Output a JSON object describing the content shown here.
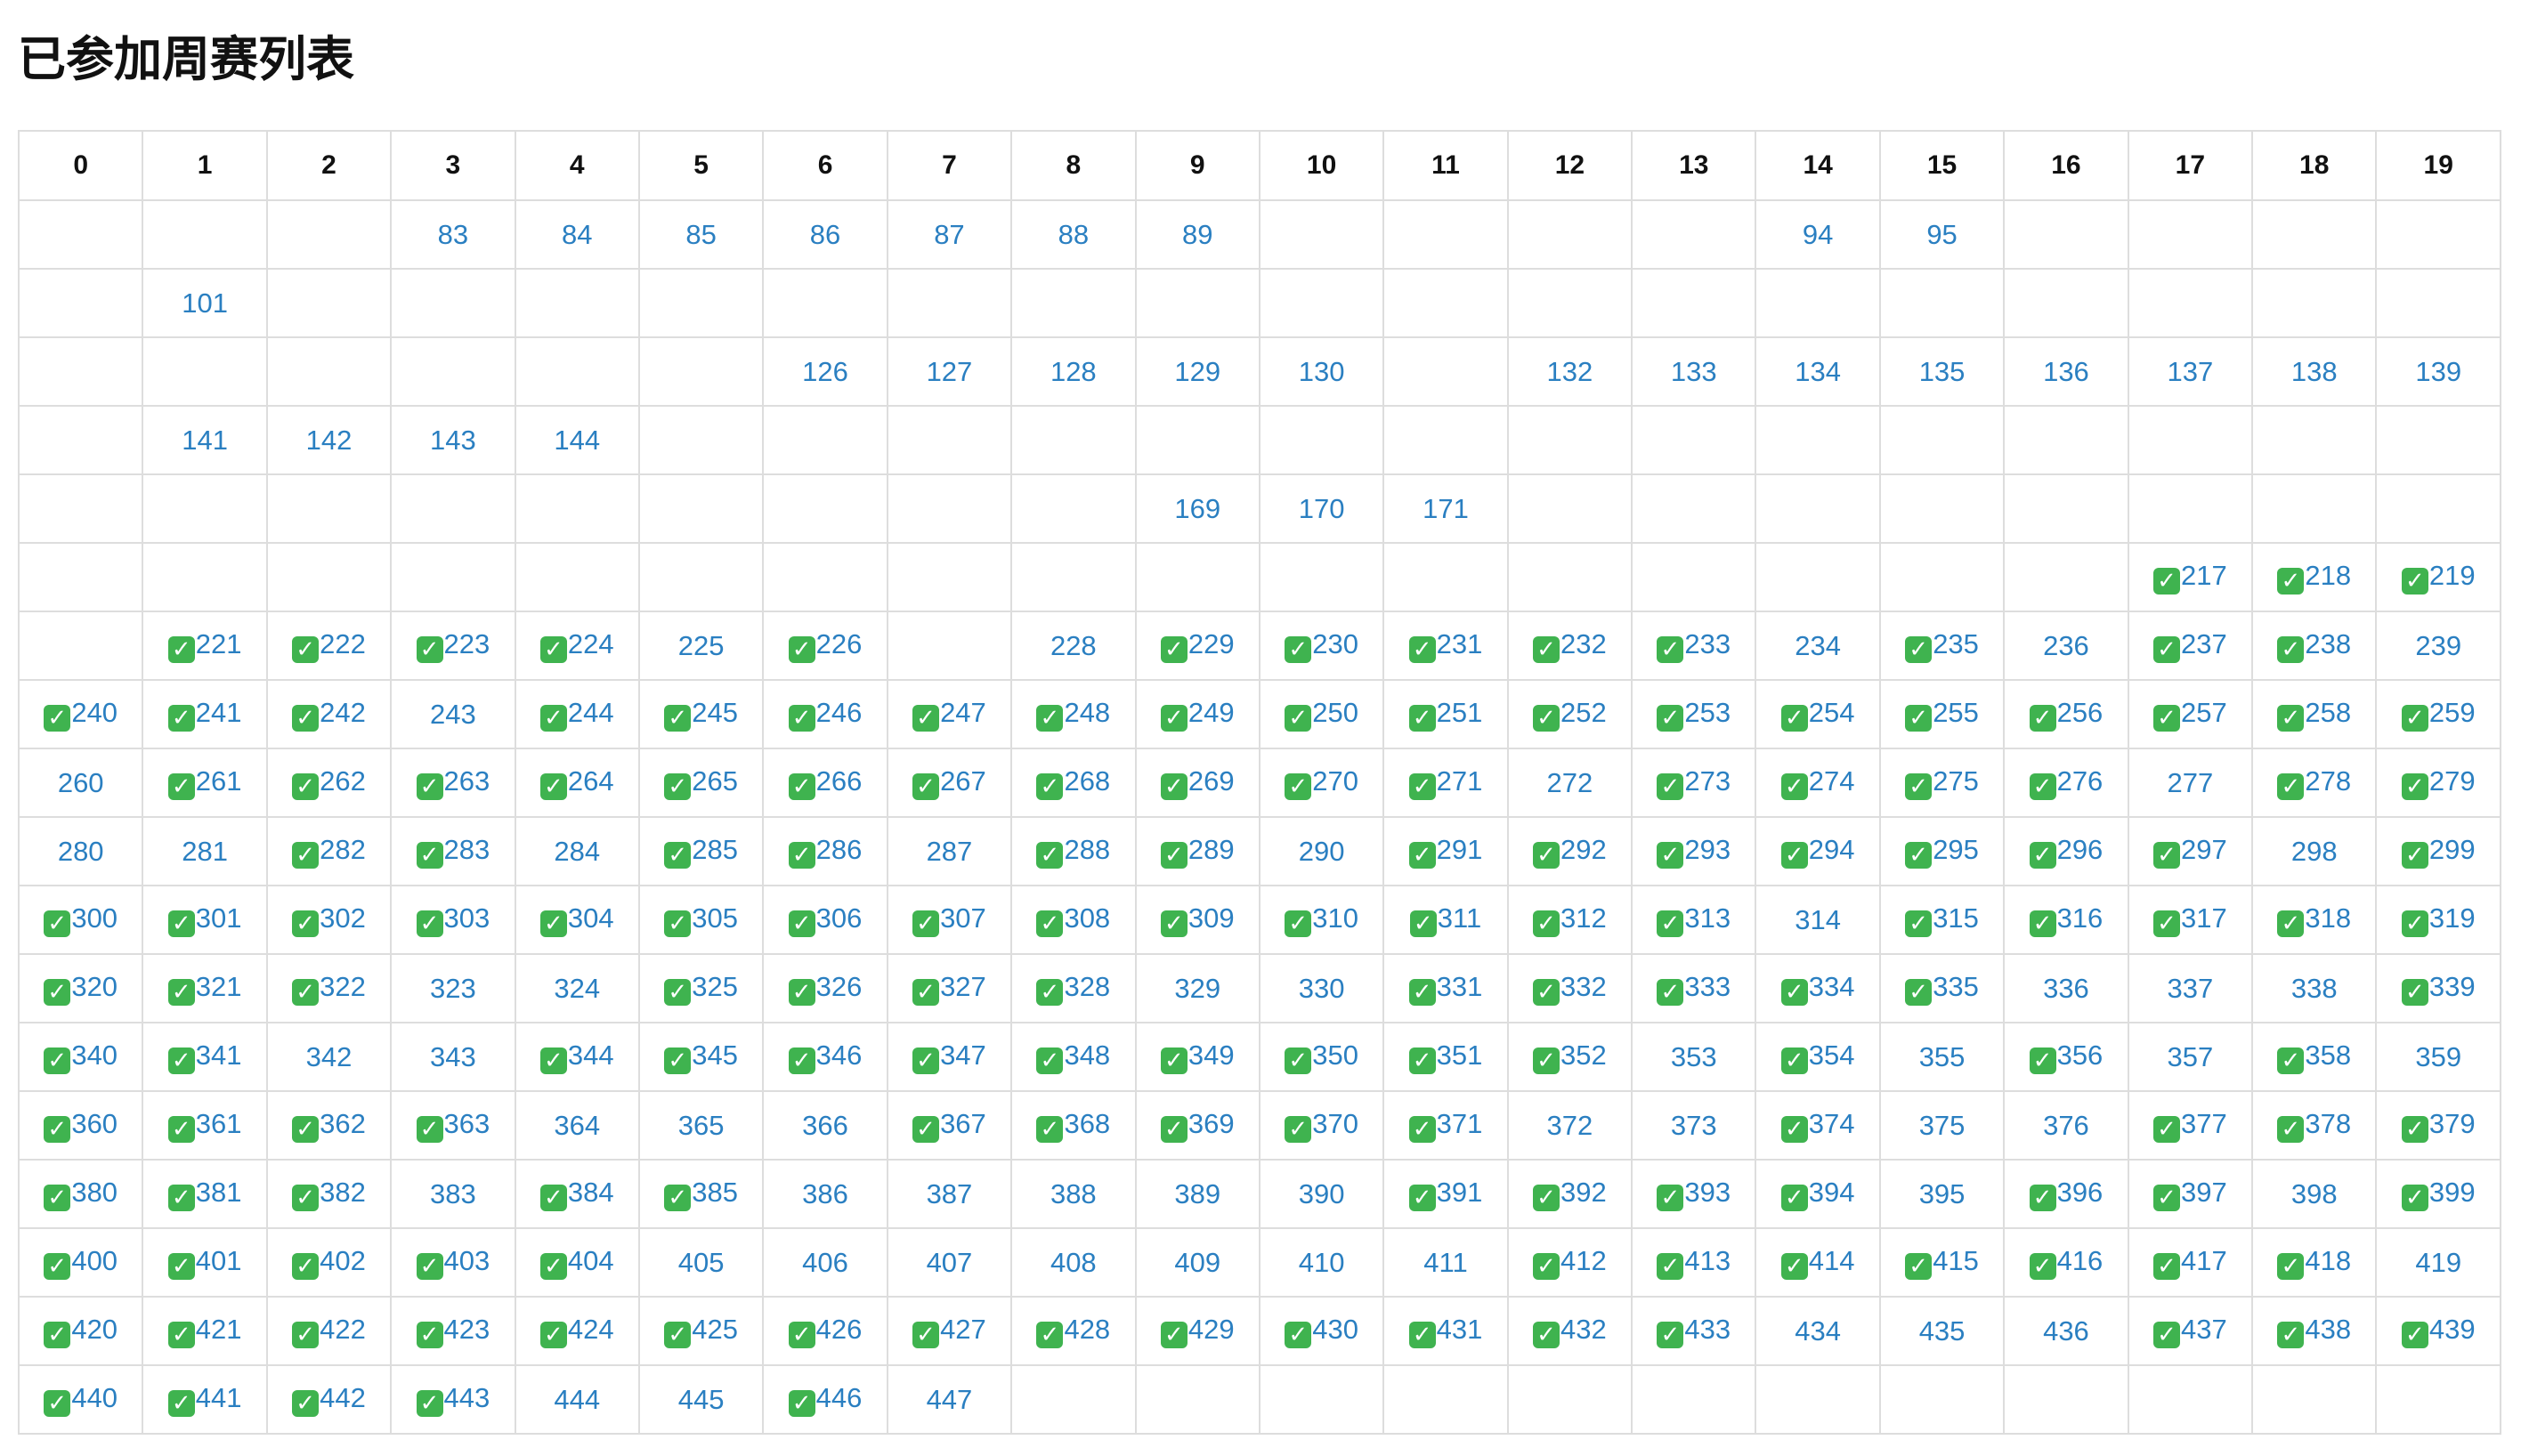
{
  "page": {
    "title": "已参加周赛列表"
  },
  "table": {
    "headers": [
      "0",
      "1",
      "2",
      "3",
      "4",
      "5",
      "6",
      "7",
      "8",
      "9",
      "10",
      "11",
      "12",
      "13",
      "14",
      "15",
      "16",
      "17",
      "18",
      "19"
    ],
    "rows": [
      [
        null,
        null,
        null,
        {
          "id": "83"
        },
        {
          "id": "84"
        },
        {
          "id": "85"
        },
        {
          "id": "86"
        },
        {
          "id": "87"
        },
        {
          "id": "88"
        },
        {
          "id": "89"
        },
        null,
        null,
        null,
        null,
        {
          "id": "94"
        },
        {
          "id": "95"
        },
        null,
        null,
        null,
        null
      ],
      [
        null,
        {
          "id": "101"
        },
        null,
        null,
        null,
        null,
        null,
        null,
        null,
        null,
        null,
        null,
        null,
        null,
        null,
        null,
        null,
        null,
        null,
        null
      ],
      [
        null,
        null,
        null,
        null,
        null,
        null,
        {
          "id": "126"
        },
        {
          "id": "127"
        },
        {
          "id": "128"
        },
        {
          "id": "129"
        },
        {
          "id": "130"
        },
        null,
        {
          "id": "132"
        },
        {
          "id": "133"
        },
        {
          "id": "134"
        },
        {
          "id": "135"
        },
        {
          "id": "136"
        },
        {
          "id": "137"
        },
        {
          "id": "138"
        },
        {
          "id": "139"
        }
      ],
      [
        null,
        {
          "id": "141"
        },
        {
          "id": "142"
        },
        {
          "id": "143"
        },
        {
          "id": "144"
        },
        null,
        null,
        null,
        null,
        null,
        null,
        null,
        null,
        null,
        null,
        null,
        null,
        null,
        null,
        null
      ],
      [
        null,
        null,
        null,
        null,
        null,
        null,
        null,
        null,
        null,
        {
          "id": "169"
        },
        {
          "id": "170"
        },
        {
          "id": "171"
        },
        null,
        null,
        null,
        null,
        null,
        null,
        null,
        null
      ],
      [
        null,
        null,
        null,
        null,
        null,
        null,
        null,
        null,
        null,
        null,
        null,
        null,
        null,
        null,
        null,
        null,
        null,
        {
          "id": "217",
          "done": true
        },
        {
          "id": "218",
          "done": true
        },
        {
          "id": "219",
          "done": true
        }
      ],
      [
        null,
        {
          "id": "221",
          "done": true
        },
        {
          "id": "222",
          "done": true
        },
        {
          "id": "223",
          "done": true
        },
        {
          "id": "224",
          "done": true
        },
        {
          "id": "225"
        },
        {
          "id": "226",
          "done": true
        },
        null,
        {
          "id": "228"
        },
        {
          "id": "229",
          "done": true
        },
        {
          "id": "230",
          "done": true
        },
        {
          "id": "231",
          "done": true
        },
        {
          "id": "232",
          "done": true
        },
        {
          "id": "233",
          "done": true
        },
        {
          "id": "234"
        },
        {
          "id": "235",
          "done": true
        },
        {
          "id": "236"
        },
        {
          "id": "237",
          "done": true
        },
        {
          "id": "238",
          "done": true
        },
        {
          "id": "239"
        }
      ],
      [
        {
          "id": "240",
          "done": true
        },
        {
          "id": "241",
          "done": true
        },
        {
          "id": "242",
          "done": true
        },
        {
          "id": "243"
        },
        {
          "id": "244",
          "done": true
        },
        {
          "id": "245",
          "done": true
        },
        {
          "id": "246",
          "done": true
        },
        {
          "id": "247",
          "done": true
        },
        {
          "id": "248",
          "done": true
        },
        {
          "id": "249",
          "done": true
        },
        {
          "id": "250",
          "done": true
        },
        {
          "id": "251",
          "done": true
        },
        {
          "id": "252",
          "done": true
        },
        {
          "id": "253",
          "done": true
        },
        {
          "id": "254",
          "done": true
        },
        {
          "id": "255",
          "done": true
        },
        {
          "id": "256",
          "done": true
        },
        {
          "id": "257",
          "done": true
        },
        {
          "id": "258",
          "done": true
        },
        {
          "id": "259",
          "done": true
        }
      ],
      [
        {
          "id": "260"
        },
        {
          "id": "261",
          "done": true
        },
        {
          "id": "262",
          "done": true
        },
        {
          "id": "263",
          "done": true
        },
        {
          "id": "264",
          "done": true
        },
        {
          "id": "265",
          "done": true
        },
        {
          "id": "266",
          "done": true
        },
        {
          "id": "267",
          "done": true
        },
        {
          "id": "268",
          "done": true
        },
        {
          "id": "269",
          "done": true
        },
        {
          "id": "270",
          "done": true
        },
        {
          "id": "271",
          "done": true
        },
        {
          "id": "272"
        },
        {
          "id": "273",
          "done": true
        },
        {
          "id": "274",
          "done": true
        },
        {
          "id": "275",
          "done": true
        },
        {
          "id": "276",
          "done": true
        },
        {
          "id": "277"
        },
        {
          "id": "278",
          "done": true
        },
        {
          "id": "279",
          "done": true
        }
      ],
      [
        {
          "id": "280"
        },
        {
          "id": "281"
        },
        {
          "id": "282",
          "done": true
        },
        {
          "id": "283",
          "done": true
        },
        {
          "id": "284"
        },
        {
          "id": "285",
          "done": true
        },
        {
          "id": "286",
          "done": true
        },
        {
          "id": "287"
        },
        {
          "id": "288",
          "done": true
        },
        {
          "id": "289",
          "done": true
        },
        {
          "id": "290"
        },
        {
          "id": "291",
          "done": true
        },
        {
          "id": "292",
          "done": true
        },
        {
          "id": "293",
          "done": true
        },
        {
          "id": "294",
          "done": true
        },
        {
          "id": "295",
          "done": true
        },
        {
          "id": "296",
          "done": true
        },
        {
          "id": "297",
          "done": true
        },
        {
          "id": "298"
        },
        {
          "id": "299",
          "done": true
        }
      ],
      [
        {
          "id": "300",
          "done": true
        },
        {
          "id": "301",
          "done": true
        },
        {
          "id": "302",
          "done": true
        },
        {
          "id": "303",
          "done": true
        },
        {
          "id": "304",
          "done": true
        },
        {
          "id": "305",
          "done": true
        },
        {
          "id": "306",
          "done": true
        },
        {
          "id": "307",
          "done": true
        },
        {
          "id": "308",
          "done": true
        },
        {
          "id": "309",
          "done": true
        },
        {
          "id": "310",
          "done": true
        },
        {
          "id": "311",
          "done": true
        },
        {
          "id": "312",
          "done": true
        },
        {
          "id": "313",
          "done": true
        },
        {
          "id": "314"
        },
        {
          "id": "315",
          "done": true
        },
        {
          "id": "316",
          "done": true
        },
        {
          "id": "317",
          "done": true
        },
        {
          "id": "318",
          "done": true
        },
        {
          "id": "319",
          "done": true
        }
      ],
      [
        {
          "id": "320",
          "done": true
        },
        {
          "id": "321",
          "done": true
        },
        {
          "id": "322",
          "done": true
        },
        {
          "id": "323"
        },
        {
          "id": "324"
        },
        {
          "id": "325",
          "done": true
        },
        {
          "id": "326",
          "done": true
        },
        {
          "id": "327",
          "done": true
        },
        {
          "id": "328",
          "done": true
        },
        {
          "id": "329"
        },
        {
          "id": "330"
        },
        {
          "id": "331",
          "done": true
        },
        {
          "id": "332",
          "done": true
        },
        {
          "id": "333",
          "done": true
        },
        {
          "id": "334",
          "done": true
        },
        {
          "id": "335",
          "done": true
        },
        {
          "id": "336"
        },
        {
          "id": "337"
        },
        {
          "id": "338"
        },
        {
          "id": "339",
          "done": true
        }
      ],
      [
        {
          "id": "340",
          "done": true
        },
        {
          "id": "341",
          "done": true
        },
        {
          "id": "342"
        },
        {
          "id": "343"
        },
        {
          "id": "344",
          "done": true
        },
        {
          "id": "345",
          "done": true
        },
        {
          "id": "346",
          "done": true
        },
        {
          "id": "347",
          "done": true
        },
        {
          "id": "348",
          "done": true
        },
        {
          "id": "349",
          "done": true
        },
        {
          "id": "350",
          "done": true
        },
        {
          "id": "351",
          "done": true
        },
        {
          "id": "352",
          "done": true
        },
        {
          "id": "353"
        },
        {
          "id": "354",
          "done": true
        },
        {
          "id": "355"
        },
        {
          "id": "356",
          "done": true
        },
        {
          "id": "357"
        },
        {
          "id": "358",
          "done": true
        },
        {
          "id": "359"
        }
      ],
      [
        {
          "id": "360",
          "done": true
        },
        {
          "id": "361",
          "done": true
        },
        {
          "id": "362",
          "done": true
        },
        {
          "id": "363",
          "done": true
        },
        {
          "id": "364"
        },
        {
          "id": "365"
        },
        {
          "id": "366"
        },
        {
          "id": "367",
          "done": true
        },
        {
          "id": "368",
          "done": true
        },
        {
          "id": "369",
          "done": true
        },
        {
          "id": "370",
          "done": true
        },
        {
          "id": "371",
          "done": true
        },
        {
          "id": "372"
        },
        {
          "id": "373"
        },
        {
          "id": "374",
          "done": true
        },
        {
          "id": "375"
        },
        {
          "id": "376"
        },
        {
          "id": "377",
          "done": true
        },
        {
          "id": "378",
          "done": true
        },
        {
          "id": "379",
          "done": true
        }
      ],
      [
        {
          "id": "380",
          "done": true
        },
        {
          "id": "381",
          "done": true
        },
        {
          "id": "382",
          "done": true
        },
        {
          "id": "383"
        },
        {
          "id": "384",
          "done": true
        },
        {
          "id": "385",
          "done": true
        },
        {
          "id": "386"
        },
        {
          "id": "387"
        },
        {
          "id": "388"
        },
        {
          "id": "389"
        },
        {
          "id": "390"
        },
        {
          "id": "391",
          "done": true
        },
        {
          "id": "392",
          "done": true
        },
        {
          "id": "393",
          "done": true
        },
        {
          "id": "394",
          "done": true
        },
        {
          "id": "395"
        },
        {
          "id": "396",
          "done": true
        },
        {
          "id": "397",
          "done": true
        },
        {
          "id": "398"
        },
        {
          "id": "399",
          "done": true
        }
      ],
      [
        {
          "id": "400",
          "done": true
        },
        {
          "id": "401",
          "done": true
        },
        {
          "id": "402",
          "done": true
        },
        {
          "id": "403",
          "done": true
        },
        {
          "id": "404",
          "done": true
        },
        {
          "id": "405"
        },
        {
          "id": "406"
        },
        {
          "id": "407"
        },
        {
          "id": "408"
        },
        {
          "id": "409"
        },
        {
          "id": "410"
        },
        {
          "id": "411"
        },
        {
          "id": "412",
          "done": true
        },
        {
          "id": "413",
          "done": true
        },
        {
          "id": "414",
          "done": true
        },
        {
          "id": "415",
          "done": true
        },
        {
          "id": "416",
          "done": true
        },
        {
          "id": "417",
          "done": true
        },
        {
          "id": "418",
          "done": true
        },
        {
          "id": "419"
        }
      ],
      [
        {
          "id": "420",
          "done": true
        },
        {
          "id": "421",
          "done": true
        },
        {
          "id": "422",
          "done": true
        },
        {
          "id": "423",
          "done": true
        },
        {
          "id": "424",
          "done": true
        },
        {
          "id": "425",
          "done": true
        },
        {
          "id": "426",
          "done": true
        },
        {
          "id": "427",
          "done": true
        },
        {
          "id": "428",
          "done": true
        },
        {
          "id": "429",
          "done": true
        },
        {
          "id": "430",
          "done": true
        },
        {
          "id": "431",
          "done": true
        },
        {
          "id": "432",
          "done": true
        },
        {
          "id": "433",
          "done": true
        },
        {
          "id": "434"
        },
        {
          "id": "435"
        },
        {
          "id": "436"
        },
        {
          "id": "437",
          "done": true
        },
        {
          "id": "438",
          "done": true
        },
        {
          "id": "439",
          "done": true
        }
      ],
      [
        {
          "id": "440",
          "done": true
        },
        {
          "id": "441",
          "done": true
        },
        {
          "id": "442",
          "done": true
        },
        {
          "id": "443",
          "done": true
        },
        {
          "id": "444"
        },
        {
          "id": "445"
        },
        {
          "id": "446",
          "done": true
        },
        {
          "id": "447"
        },
        null,
        null,
        null,
        null,
        null,
        null,
        null,
        null,
        null,
        null,
        null,
        null
      ]
    ]
  },
  "icons": {
    "done_icon": "check-mark-button-icon",
    "check_glyph": "✓"
  },
  "colors": {
    "link": "#2a7fc1",
    "check_bg": "#3fb34f",
    "border": "#dddddd"
  }
}
